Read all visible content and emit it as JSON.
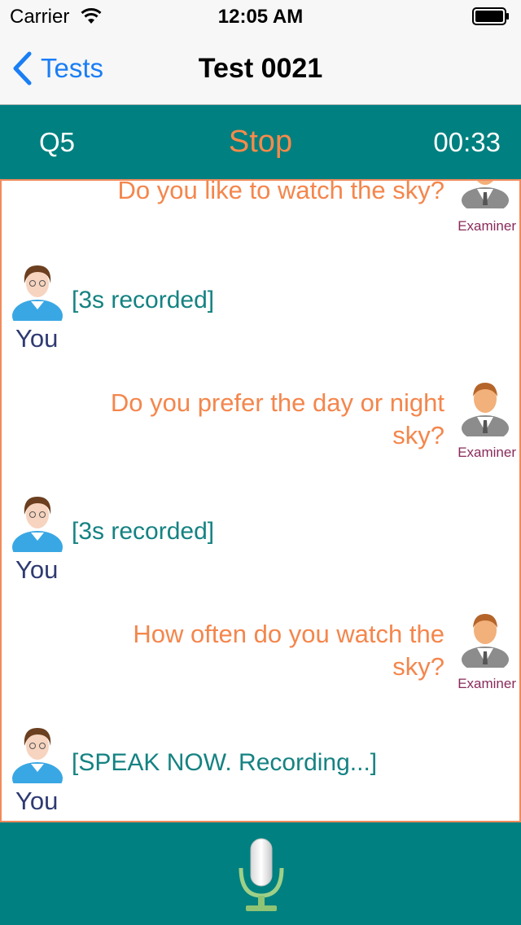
{
  "status_bar": {
    "carrier": "Carrier",
    "time": "12:05 AM"
  },
  "nav": {
    "back_label": "Tests",
    "title": "Test 0021"
  },
  "controls": {
    "question": "Q5",
    "stop_label": "Stop",
    "timer": "00:33"
  },
  "chat": {
    "messages": [
      {
        "role": "examiner",
        "lines": [
          "Do you like to watch the sky?"
        ],
        "label": "Examiner"
      },
      {
        "role": "user",
        "text": "[3s recorded]",
        "label": "You"
      },
      {
        "role": "examiner",
        "lines": [
          "Do you prefer the day or night",
          "sky?"
        ],
        "label": "Examiner"
      },
      {
        "role": "user",
        "text": "[3s recorded]",
        "label": "You"
      },
      {
        "role": "examiner",
        "lines": [
          "How often do you watch the",
          "sky?"
        ],
        "label": "Examiner"
      },
      {
        "role": "user",
        "text": "[SPEAK NOW. Recording...]",
        "label": "You"
      }
    ]
  },
  "bottom": {
    "mic_icon": "microphone-icon"
  },
  "colors": {
    "teal": "#008080",
    "accent_orange": "#f4864c",
    "user_text": "#158282",
    "ios_blue": "#1a7ef5"
  }
}
